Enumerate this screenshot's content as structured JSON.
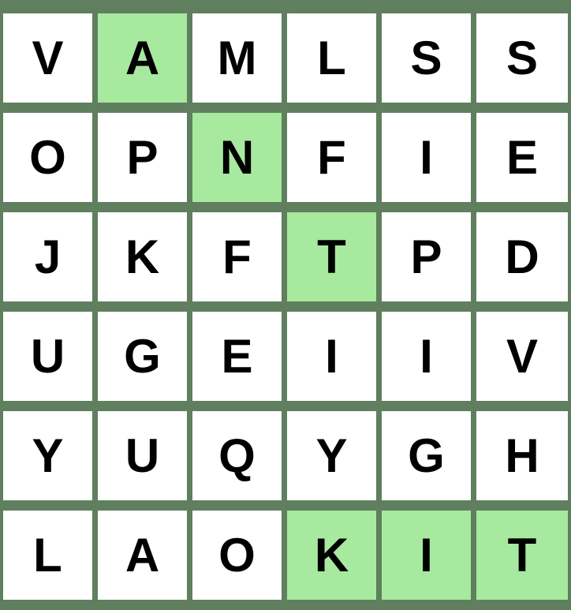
{
  "colors": {
    "board_background": "#5f7f5f",
    "cell_default": "#ffffff",
    "cell_highlight": "#a7e99e",
    "letter": "#000000"
  },
  "grid": {
    "rows": [
      [
        {
          "letter": "V",
          "highlighted": false
        },
        {
          "letter": "A",
          "highlighted": true
        },
        {
          "letter": "M",
          "highlighted": false
        },
        {
          "letter": "L",
          "highlighted": false
        },
        {
          "letter": "S",
          "highlighted": false
        },
        {
          "letter": "S",
          "highlighted": false
        }
      ],
      [
        {
          "letter": "O",
          "highlighted": false
        },
        {
          "letter": "P",
          "highlighted": false
        },
        {
          "letter": "N",
          "highlighted": true
        },
        {
          "letter": "F",
          "highlighted": false
        },
        {
          "letter": "I",
          "highlighted": false
        },
        {
          "letter": "E",
          "highlighted": false
        }
      ],
      [
        {
          "letter": "J",
          "highlighted": false
        },
        {
          "letter": "K",
          "highlighted": false
        },
        {
          "letter": "F",
          "highlighted": false
        },
        {
          "letter": "T",
          "highlighted": true
        },
        {
          "letter": "P",
          "highlighted": false
        },
        {
          "letter": "D",
          "highlighted": false
        }
      ],
      [
        {
          "letter": "U",
          "highlighted": false
        },
        {
          "letter": "G",
          "highlighted": false
        },
        {
          "letter": "E",
          "highlighted": false
        },
        {
          "letter": "I",
          "highlighted": false
        },
        {
          "letter": "I",
          "highlighted": false
        },
        {
          "letter": "V",
          "highlighted": false
        }
      ],
      [
        {
          "letter": "Y",
          "highlighted": false
        },
        {
          "letter": "U",
          "highlighted": false
        },
        {
          "letter": "Q",
          "highlighted": false
        },
        {
          "letter": "Y",
          "highlighted": false
        },
        {
          "letter": "G",
          "highlighted": false
        },
        {
          "letter": "H",
          "highlighted": false
        }
      ],
      [
        {
          "letter": "L",
          "highlighted": false
        },
        {
          "letter": "A",
          "highlighted": false
        },
        {
          "letter": "O",
          "highlighted": false
        },
        {
          "letter": "K",
          "highlighted": true
        },
        {
          "letter": "I",
          "highlighted": true
        },
        {
          "letter": "T",
          "highlighted": true
        }
      ]
    ]
  }
}
